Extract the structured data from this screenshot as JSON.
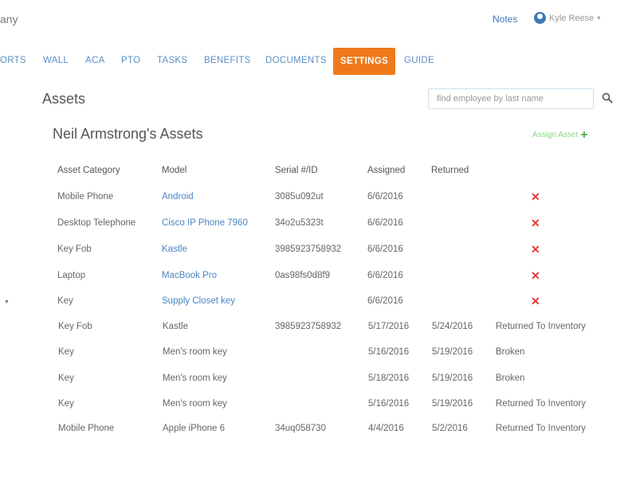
{
  "header": {
    "brand": "any",
    "notes_label": "Notes",
    "user_name": "Kyle Reese",
    "caret": "▾"
  },
  "nav": {
    "items": [
      "ORTS",
      "WALL",
      "ACA",
      "PTO",
      "TASKS",
      "BENEFITS",
      "DOCUMENTS",
      "SETTINGS",
      "GUIDE"
    ],
    "active": "SETTINGS"
  },
  "page": {
    "title": "Assets",
    "search_placeholder": "find employee by last name",
    "section_title": "Neil Armstrong's Assets",
    "assign_label": "Assign Asset"
  },
  "table": {
    "columns": [
      "Asset Category",
      "Model",
      "Serial #/ID",
      "Assigned",
      "Returned"
    ],
    "rows": [
      {
        "category": "Mobile Phone",
        "model": "Android",
        "serial": "3085u092ut",
        "assigned": "6/6/2016",
        "returned": "",
        "status": "",
        "active": true
      },
      {
        "category": "Desktop Telephone",
        "model": "Cisco IP Phone 7960",
        "serial": "34o2u5323t",
        "assigned": "6/6/2016",
        "returned": "",
        "status": "",
        "active": true
      },
      {
        "category": "Key Fob",
        "model": "Kastle",
        "serial": "3985923758932",
        "assigned": "6/6/2016",
        "returned": "",
        "status": "",
        "active": true
      },
      {
        "category": "Laptop",
        "model": "MacBook Pro",
        "serial": "0as98fs0d8f9",
        "assigned": "6/6/2016",
        "returned": "",
        "status": "",
        "active": true
      },
      {
        "category": "Key",
        "model": "Supply Closet key",
        "serial": "",
        "assigned": "6/6/2016",
        "returned": "",
        "status": "",
        "active": true
      },
      {
        "category": "Key Fob",
        "model": "Kastle",
        "serial": "3985923758932",
        "assigned": "5/17/2016",
        "returned": "5/24/2016",
        "status": "Returned To Inventory",
        "active": false
      },
      {
        "category": "Key",
        "model": "Men's room key",
        "serial": "",
        "assigned": "5/16/2016",
        "returned": "5/19/2016",
        "status": "Broken",
        "active": false
      },
      {
        "category": "Key",
        "model": "Men's room key",
        "serial": "",
        "assigned": "5/18/2016",
        "returned": "5/19/2016",
        "status": "Broken",
        "active": false
      },
      {
        "category": "Key",
        "model": "Men's room key",
        "serial": "",
        "assigned": "5/16/2016",
        "returned": "5/19/2016",
        "status": "Returned To Inventory",
        "active": false
      },
      {
        "category": "Mobile Phone",
        "model": "Apple iPhone 6",
        "serial": "34uq058730",
        "assigned": "4/4/2016",
        "returned": "5/2/2016",
        "status": "Returned To Inventory",
        "active": false
      }
    ],
    "delete_glyph": "✕",
    "row_marker": "▼"
  },
  "colors": {
    "accent": "#f07a1a",
    "link": "#4a86c2",
    "delete": "#e53935",
    "add": "#4caf50"
  }
}
